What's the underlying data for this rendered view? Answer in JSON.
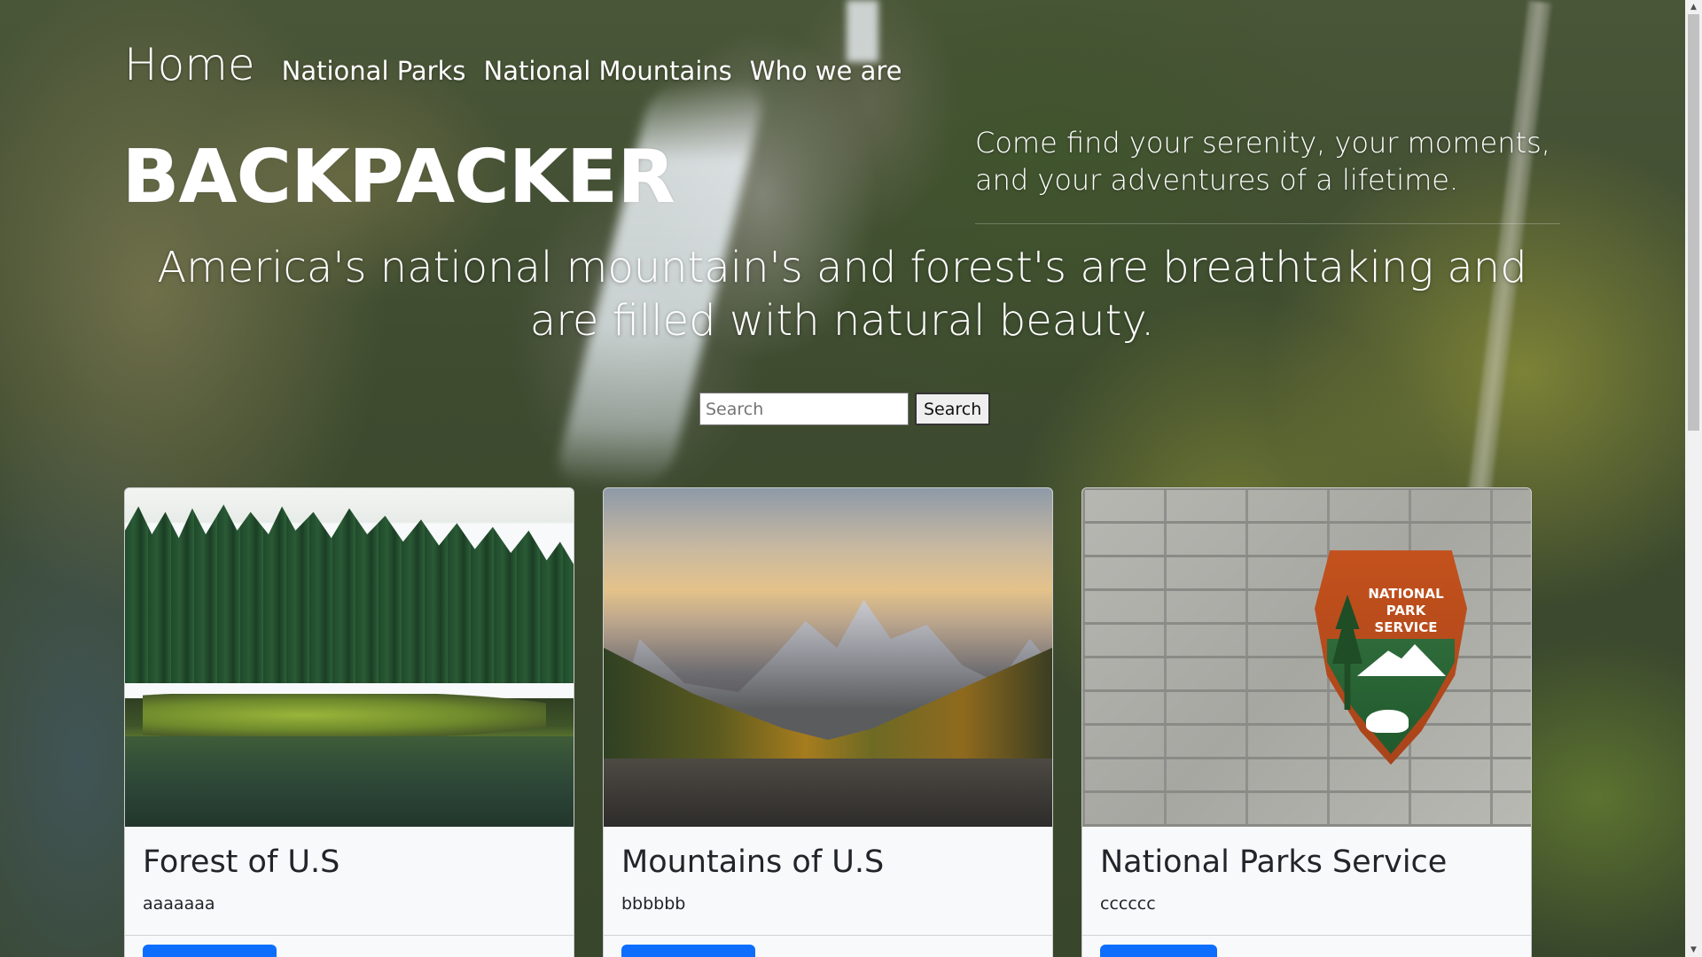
{
  "nav": {
    "home": "Home",
    "items": [
      "National Parks",
      "National Mountains",
      "Who we are"
    ]
  },
  "hero": {
    "logo_text": "BACKPACKER",
    "tagline": "Come find your serenity, your moments, and your adventures of a lifetime.",
    "headline": "America's national mountain's and forest's are breathtaking and are filled with natural beauty."
  },
  "search": {
    "placeholder": "Search",
    "button_label": "Search"
  },
  "cards": [
    {
      "title": "Forest of U.S",
      "text": "aaaaaaa",
      "image": "forest-lake-photo"
    },
    {
      "title": "Mountains of U.S",
      "text": "bbbbbb",
      "image": "mountain-valley-photo"
    },
    {
      "title": "National Parks Service",
      "text": "cccccc",
      "image": "nps-badge-photo",
      "badge_text": "NATIONAL PARK SERVICE"
    }
  ],
  "colors": {
    "card_button": "#0d6efd",
    "card_background": "#f8f9fa"
  }
}
